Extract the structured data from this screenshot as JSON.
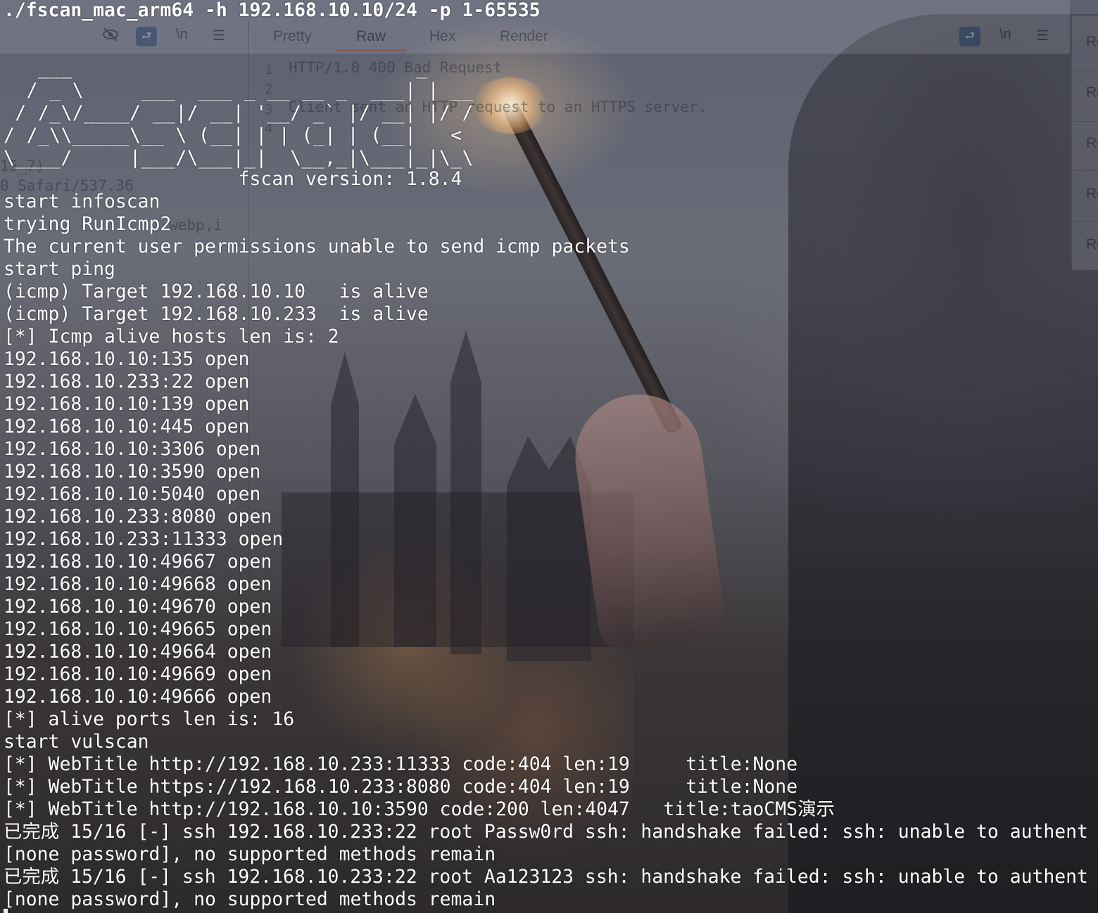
{
  "ghost_app": {
    "tabs": [
      {
        "label": "Pretty",
        "active": false
      },
      {
        "label": "Raw",
        "active": true
      },
      {
        "label": "Hex",
        "active": false
      },
      {
        "label": "Render",
        "active": false
      }
    ],
    "toolbar_icons_left": [
      "eye-off-icon",
      "wrap-icon",
      "newline-icon",
      "menu-icon"
    ],
    "toolbar_icons_right": [
      "wrap-icon",
      "newline-icon",
      "menu-icon"
    ],
    "newline_label": "\\n",
    "response_lines": [
      {
        "num": "1",
        "text": "HTTP/1.0 400 Bad Request"
      },
      {
        "num": "2",
        "text": ""
      },
      {
        "num": "3",
        "text": "Client sent an HTTP request to an HTTPS server."
      },
      {
        "num": "4",
        "text": ""
      }
    ],
    "request_fragments": [
      "15_7)",
      "0 Safari/537.36",
      "webp,i"
    ],
    "side_items": [
      "Re",
      "Re",
      "Re",
      "Re",
      "Re"
    ],
    "accent_color": "#c85a2a"
  },
  "terminal": {
    "command": "./fscan_mac_arm64 -h 192.168.10.10/24 -p 1-65535",
    "banner": [
      "   ___                              _    ",
      "  / _ \\     ___  ___ _ __ __ _  ___| | __ ",
      " / /_\\/____/ __|/ __| '__/ _` |/ __| |/ /",
      "/ /_\\\\_____\\__ \\ (__| | | (_| | (__|   <    ",
      "\\____/     |___/\\___|_|  \\__,_|\\___|_|\\_\\   "
    ],
    "version": "                     fscan version: 1.8.4",
    "output": [
      "start infoscan",
      "trying RunIcmp2",
      "The current user permissions unable to send icmp packets",
      "start ping",
      "(icmp) Target 192.168.10.10   is alive",
      "(icmp) Target 192.168.10.233  is alive",
      "[*] Icmp alive hosts len is: 2",
      "192.168.10.10:135 open",
      "192.168.10.233:22 open",
      "192.168.10.10:139 open",
      "192.168.10.10:445 open",
      "192.168.10.10:3306 open",
      "192.168.10.10:3590 open",
      "192.168.10.10:5040 open",
      "192.168.10.233:8080 open",
      "192.168.10.233:11333 open",
      "192.168.10.10:49667 open",
      "192.168.10.10:49668 open",
      "192.168.10.10:49670 open",
      "192.168.10.10:49665 open",
      "192.168.10.10:49664 open",
      "192.168.10.10:49669 open",
      "192.168.10.10:49666 open",
      "[*] alive ports len is: 16",
      "start vulscan",
      "[*] WebTitle http://192.168.10.233:11333 code:404 len:19     title:None",
      "[*] WebTitle https://192.168.10.233:8080 code:404 len:19     title:None",
      "[*] WebTitle http://192.168.10.10:3590 code:200 len:4047   title:taoCMS演示",
      "已完成 15/16 [-] ssh 192.168.10.233:22 root Passw0rd ssh: handshake failed: ssh: unable to authent",
      "[none password], no supported methods remain",
      "已完成 15/16 [-] ssh 192.168.10.233:22 root Aa123123 ssh: handshake failed: ssh: unable to authent",
      "[none password], no supported methods remain"
    ]
  }
}
